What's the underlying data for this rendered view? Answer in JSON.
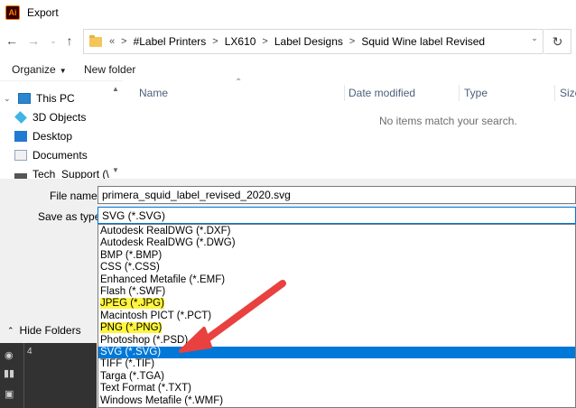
{
  "window": {
    "app_icon_text": "Ai",
    "title": "Export"
  },
  "address": {
    "lead": "«",
    "breadcrumbs": [
      "#Label Printers",
      "LX610",
      "Label Designs",
      "Squid Wine label Revised"
    ]
  },
  "toolbar": {
    "organize_label": "Organize",
    "new_folder_label": "New folder"
  },
  "nav_pane": {
    "items": [
      {
        "label": "This PC",
        "icon": "pc-icon"
      },
      {
        "label": "3D Objects",
        "icon": "cube-icon"
      },
      {
        "label": "Desktop",
        "icon": "desktop-icon"
      },
      {
        "label": "Documents",
        "icon": "documents-icon"
      },
      {
        "label": "Tech_Support (\\",
        "icon": "network-drive-icon"
      }
    ]
  },
  "content": {
    "columns": [
      "Name",
      "Date modified",
      "Type",
      "Size"
    ],
    "empty_message": "No items match your search."
  },
  "form": {
    "filename_label": "File name:",
    "filename_value": "primera_squid_label_revised_2020.svg",
    "savetype_label": "Save as type:",
    "savetype_value": "SVG (*.SVG)",
    "hide_folders_label": "Hide Folders"
  },
  "file_types": {
    "options": [
      {
        "label": "Autodesk RealDWG (*.DXF)",
        "highlighted": false,
        "selected": false
      },
      {
        "label": "Autodesk RealDWG (*.DWG)",
        "highlighted": false,
        "selected": false
      },
      {
        "label": "BMP (*.BMP)",
        "highlighted": false,
        "selected": false
      },
      {
        "label": "CSS (*.CSS)",
        "highlighted": false,
        "selected": false
      },
      {
        "label": "Enhanced Metafile (*.EMF)",
        "highlighted": false,
        "selected": false
      },
      {
        "label": "Flash (*.SWF)",
        "highlighted": false,
        "selected": false
      },
      {
        "label": "JPEG (*.JPG)",
        "highlighted": true,
        "selected": false
      },
      {
        "label": "Macintosh PICT (*.PCT)",
        "highlighted": false,
        "selected": false
      },
      {
        "label": "PNG (*.PNG)",
        "highlighted": true,
        "selected": false
      },
      {
        "label": "Photoshop (*.PSD)",
        "highlighted": false,
        "selected": false
      },
      {
        "label": "SVG (*.SVG)",
        "highlighted": false,
        "selected": true
      },
      {
        "label": "TIFF (*.TIF)",
        "highlighted": false,
        "selected": false
      },
      {
        "label": "Targa (*.TGA)",
        "highlighted": false,
        "selected": false
      },
      {
        "label": "Text Format (*.TXT)",
        "highlighted": false,
        "selected": false
      },
      {
        "label": "Windows Metafile (*.WMF)",
        "highlighted": false,
        "selected": false
      }
    ]
  },
  "artboard_strip": {
    "number": "4"
  },
  "colors": {
    "selection": "#0078d7",
    "highlight": "#fff53d",
    "arrow": "#e8413f",
    "column_header": "#4c607a"
  }
}
